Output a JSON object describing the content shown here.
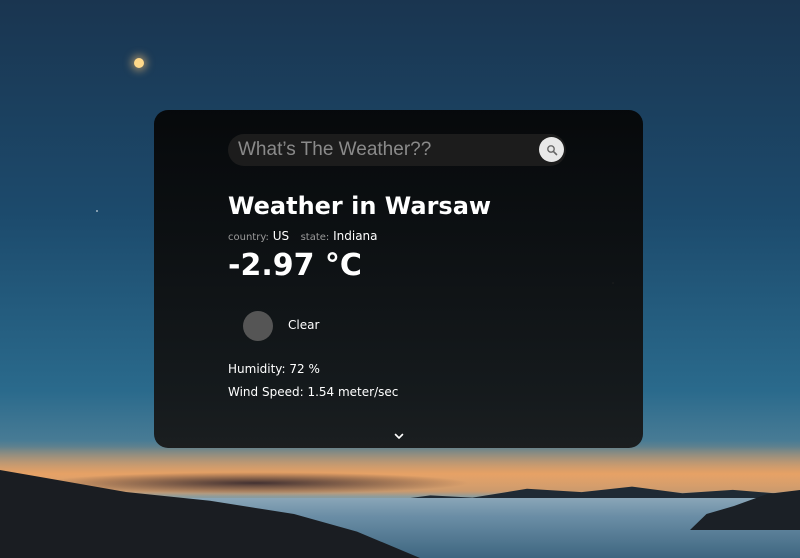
{
  "search": {
    "placeholder": "What’s The Weather??",
    "value": "",
    "icon": "search-icon"
  },
  "weather": {
    "title": "Weather in Warsaw",
    "country_label": "country:",
    "country": "US",
    "state_label": "state:",
    "state": "Indiana",
    "temperature": "-2.97 °C",
    "description": "Clear",
    "humidity": "Humidity: 72 %",
    "wind_speed": "Wind Speed: 1.54 meter/sec"
  },
  "controls": {
    "expand_icon": "chevron-down-icon"
  },
  "colors": {
    "card_bg": "#0b0b0b",
    "text": "#ffffff",
    "muted": "#9a9a9a",
    "icon_placeholder": "#555555"
  }
}
